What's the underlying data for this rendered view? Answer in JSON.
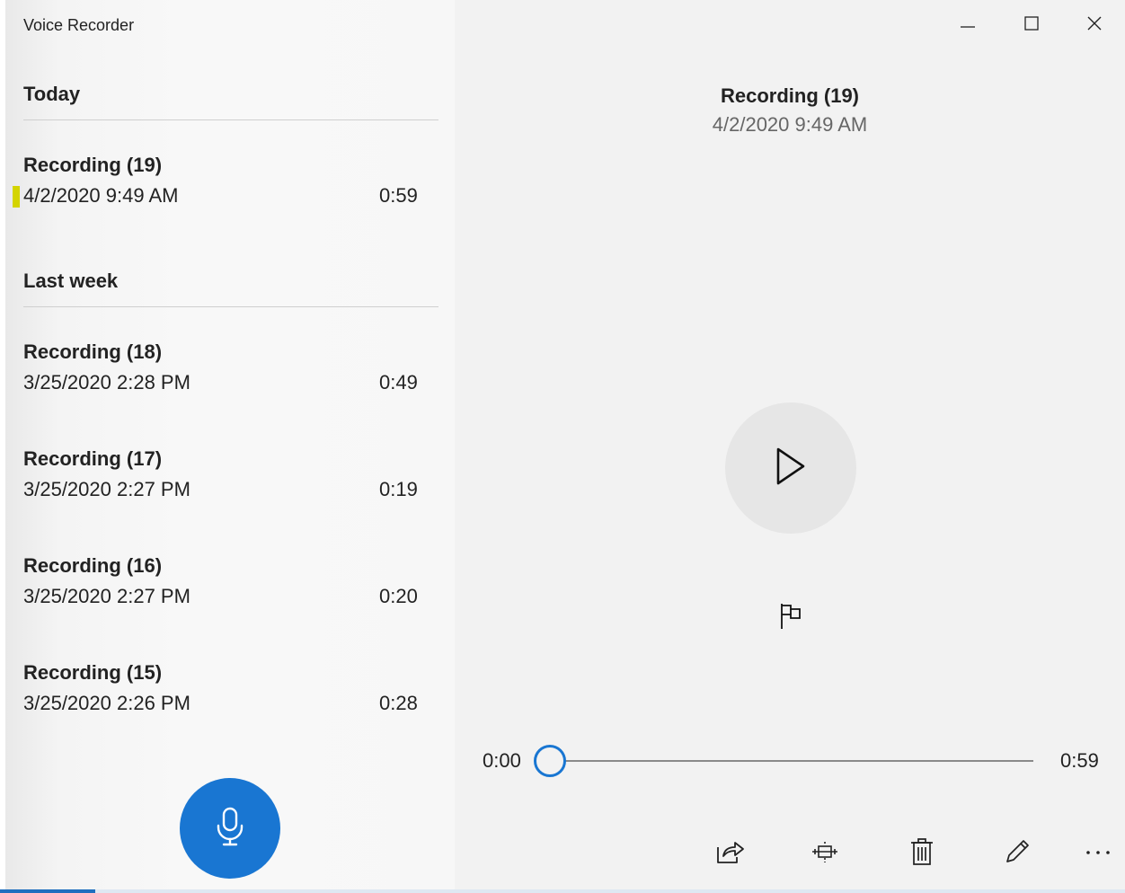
{
  "app": {
    "title": "Voice Recorder"
  },
  "window_controls": {
    "minimize_icon": "minimize-icon",
    "maximize_icon": "maximize-icon",
    "close_icon": "close-icon"
  },
  "recordings": {
    "groups": [
      {
        "header": "Today",
        "items": [
          {
            "name": "Recording (19)",
            "date": "4/2/2020 9:49 AM",
            "duration": "0:59",
            "selected": true
          }
        ]
      },
      {
        "header": "Last week",
        "items": [
          {
            "name": "Recording (18)",
            "date": "3/25/2020 2:28 PM",
            "duration": "0:49"
          },
          {
            "name": "Recording (17)",
            "date": "3/25/2020 2:27 PM",
            "duration": "0:19"
          },
          {
            "name": "Recording (16)",
            "date": "3/25/2020 2:27 PM",
            "duration": "0:20"
          },
          {
            "name": "Recording (15)",
            "date": "3/25/2020 2:26 PM",
            "duration": "0:28"
          }
        ]
      }
    ],
    "record_button_icon": "microphone-icon"
  },
  "detail": {
    "title": "Recording (19)",
    "date": "4/2/2020 9:49 AM",
    "play_icon": "play-icon",
    "marker_icon": "flag-icon",
    "playback": {
      "current_time": "0:00",
      "total_time": "0:59",
      "progress": 0
    },
    "toolbar": [
      "share-icon",
      "trim-icon",
      "delete-icon",
      "rename-icon",
      "more-icon"
    ]
  },
  "colors": {
    "accent": "#1976d2",
    "selected_indicator": "#d4d400",
    "play_button_bg": "#e6e6e6",
    "pane_bg": "#f2f2f2"
  }
}
